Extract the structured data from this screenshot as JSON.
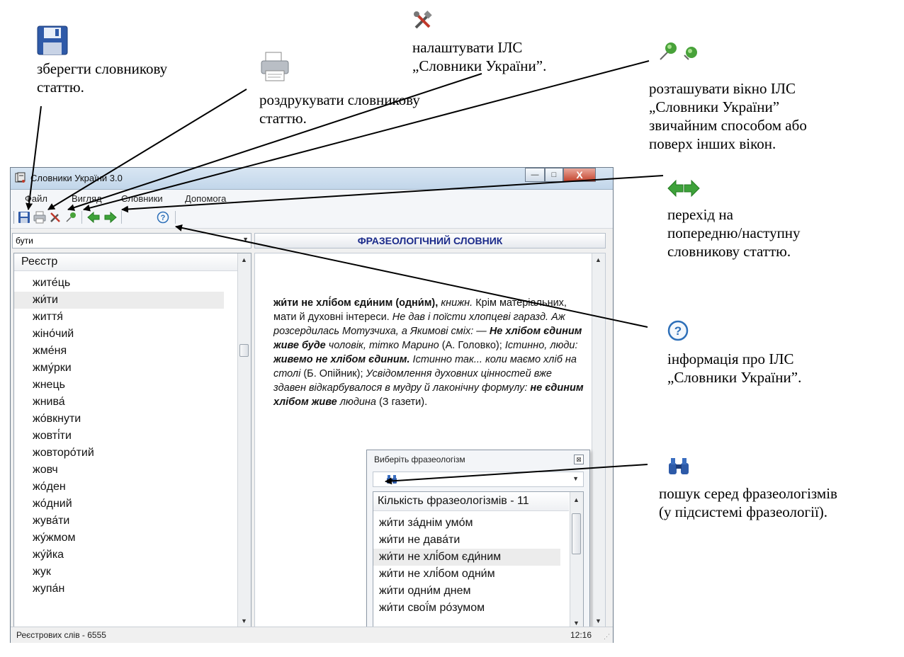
{
  "window": {
    "title": "Словники України 3.0",
    "controls": {
      "minimize": "—",
      "maximize": "□",
      "close": "X"
    }
  },
  "menu": [
    "Файл",
    "Вигляд",
    "Словники",
    "Допомога"
  ],
  "toolbar_icons": [
    "save-icon",
    "print-icon",
    "settings-icon",
    "pin-icon",
    "back-arrow-icon",
    "forward-arrow-icon",
    "help-icon"
  ],
  "search": {
    "value": "бути"
  },
  "dictionary_header": "ФРАЗЕОЛОГІЧНИЙ СЛОВНИК",
  "registry": {
    "header": "Реєстр",
    "items": [
      "жите́ць",
      "жи́ти",
      "життя́",
      "жіно́чий",
      "жме́ня",
      "жму́рки",
      "жнець",
      "жнива́",
      "жо́вкнути",
      "жовті́ти",
      "жовторо́тий",
      "жовч",
      "жо́ден",
      "жо́дний",
      "жува́ти",
      "жу́жмом",
      "жу́йка",
      "жук",
      "жупа́н"
    ],
    "selected_index": 1
  },
  "article": {
    "headword": "жи́ти не хлі́бом єди́ним (одни́м),",
    "label": "книжн.",
    "definition": "Крім матеріальних, мати й духовні інтереси.",
    "ex1": "Не дав і поїсти хлопцеві гаразд. Аж розсердилась Мотузчиха, а Якимові сміх: —",
    "ex1_bold": "Не хлібом єдиним живе буде",
    "ex1_tail": "чоловік, тітко Марино",
    "src1": "(А. Головко);",
    "ex2": "Істинно, люди:",
    "ex2_bold": "живемо не хлібом єдиним.",
    "ex2_tail": "Істинно так... коли маємо хліб на столі",
    "src2": "(Б. Опійник);",
    "ex3": "Усвідомлення духовних цінностей вже здавен відкарбувалося в мудру й лаконічну формулу:",
    "ex3_bold": "не єдиним хлібом живе",
    "ex3_tail": "людина",
    "src3": "(З газети)."
  },
  "popup": {
    "title": "Виберіть фразеологізм",
    "close": "⊠",
    "count_header": "Кількість фразеологізмів - 11",
    "items": [
      "жи́ти за́днім умо́м",
      "жи́ти не дава́ти",
      "жи́ти не хлі́бом єди́ним",
      "жи́ти не хлі́бом одни́м",
      "жи́ти одни́м днем",
      "жи́ти свої́м ро́зумом"
    ],
    "selected_index": 2
  },
  "status": {
    "left": "Реєстрових слів - 6555",
    "right": "12:16"
  },
  "callouts": {
    "save": [
      "зберегти словникову",
      "статтю."
    ],
    "print": [
      "роздрукувати словникову",
      "статтю."
    ],
    "settings": [
      "налаштувати ІЛС",
      "„Словники України”."
    ],
    "pin": [
      "розташувати вікно ІЛС",
      "„Словники України”",
      "звичайним способом або",
      "поверх інших вікон."
    ],
    "nav": [
      "перехід на",
      "попередню/наступну",
      "словникову статтю."
    ],
    "help": [
      "інформація про ІЛС",
      "„Словники України”."
    ],
    "search": [
      "пошук серед фразеологізмів",
      "(у підсистемі фразеології)."
    ]
  },
  "colors": {
    "accent_blue": "#1a2a8a",
    "arrow_green": "#3ea23a",
    "help_blue": "#2d6fb8"
  }
}
